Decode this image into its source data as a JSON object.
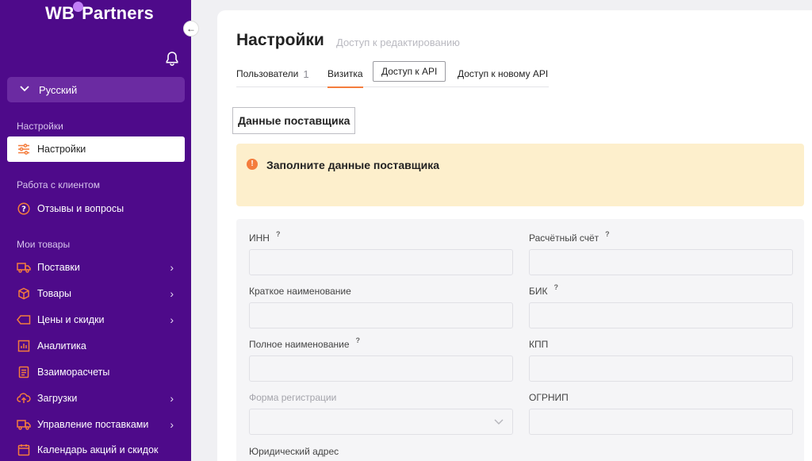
{
  "sidebar": {
    "logo_left": "WB",
    "logo_right": "Partners",
    "collapse_glyph": "←",
    "language": "Русский",
    "sections": {
      "settings": "Настройки",
      "client_work": "Работа с клиентом",
      "my_goods": "Мои товары"
    },
    "items": [
      {
        "label": "Настройки",
        "icon": "sliders-icon"
      },
      {
        "label": "Отзывы и вопросы",
        "icon": "question-circle-icon"
      },
      {
        "label": "Поставки",
        "icon": "truck-icon"
      },
      {
        "label": "Товары",
        "icon": "box-icon"
      },
      {
        "label": "Цены и скидки",
        "icon": "price-tag-icon"
      },
      {
        "label": "Аналитика",
        "icon": "chart-icon"
      },
      {
        "label": "Взаиморасчеты",
        "icon": "document-icon"
      },
      {
        "label": "Загрузки",
        "icon": "upload-cloud-icon"
      },
      {
        "label": "Управление поставками",
        "icon": "truck-manage-icon"
      },
      {
        "label": "Календарь акций и скидок",
        "icon": "calendar-icon"
      }
    ],
    "arrow": "›"
  },
  "header": {
    "title": "Настройки",
    "subtitle": "Доступ к редактированию"
  },
  "tabs": [
    {
      "label": "Пользователи",
      "count": "1"
    },
    {
      "label": "Визитка"
    },
    {
      "label": "Доступ к API"
    },
    {
      "label": "Доступ к новому API"
    }
  ],
  "supplier": {
    "heading": "Данные поставщика",
    "alert_icon": "!",
    "alert_text": "Заполните данные поставщика"
  },
  "form": {
    "qmark": "?",
    "inn": "ИНН",
    "account": "Расчётный счёт",
    "short_name": "Краткое наименование",
    "bik": "БИК",
    "full_name": "Полное наименование",
    "kpp": "КПП",
    "reg_form": "Форма регистрации",
    "ogrnip": "ОГРНИП",
    "legal_address": "Юридический адрес"
  },
  "colors": {
    "sidebar_bg": "#4e0a8a",
    "accent_orange": "#f47c3c",
    "alert_bg": "#fdefcc"
  }
}
